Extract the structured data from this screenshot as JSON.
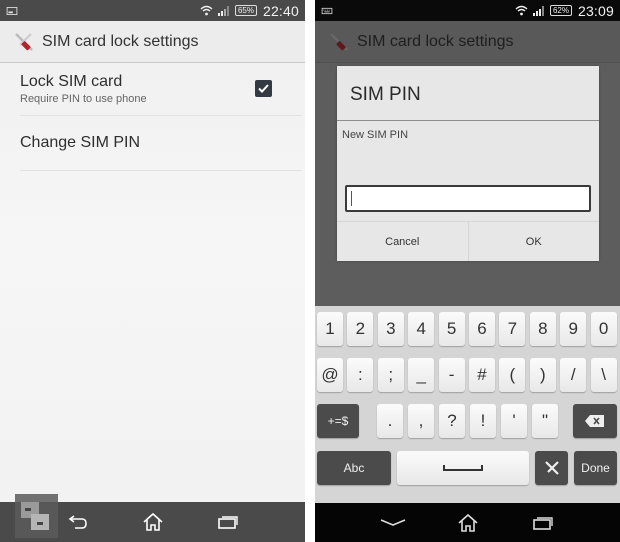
{
  "left_screen": {
    "status_bar": {
      "notification_icon": "image-notification-icon",
      "battery": "65%",
      "time": "22:40"
    },
    "action_bar": {
      "icon": "settings-tools-icon",
      "title": "SIM card lock settings"
    },
    "list": [
      {
        "title": "Lock SIM card",
        "subtitle": "Require PIN to use phone",
        "checked": true
      },
      {
        "title": "Change SIM PIN"
      }
    ],
    "nav_bar": [
      "back",
      "home",
      "recent-apps"
    ]
  },
  "right_screen": {
    "status_bar": {
      "notification_icon": "keyboard-notification-icon",
      "battery": "62%",
      "time": "23:09"
    },
    "action_bar": {
      "icon": "settings-tools-icon",
      "title": "SIM card lock settings"
    },
    "dialog": {
      "title": "SIM PIN",
      "message": "New SIM PIN",
      "input_value": "",
      "cancel_label": "Cancel",
      "ok_label": "OK"
    },
    "keyboard": {
      "row1": [
        "1",
        "2",
        "3",
        "4",
        "5",
        "6",
        "7",
        "8",
        "9",
        "0"
      ],
      "row2": [
        "@",
        ":",
        ";",
        "_",
        "-",
        "#",
        "(",
        ")",
        "/",
        "\\"
      ],
      "row3": {
        "shift_label": "+=$",
        "keys": [
          ".",
          ",",
          "?",
          "!",
          "'",
          "\""
        ],
        "backspace": "backspace-icon"
      },
      "row4": {
        "abc_label": "Abc",
        "space": "space-icon",
        "settings": "tools-icon",
        "done_label": "Done"
      }
    },
    "nav_bar": [
      "hide-keyboard",
      "home",
      "recent-apps"
    ]
  }
}
